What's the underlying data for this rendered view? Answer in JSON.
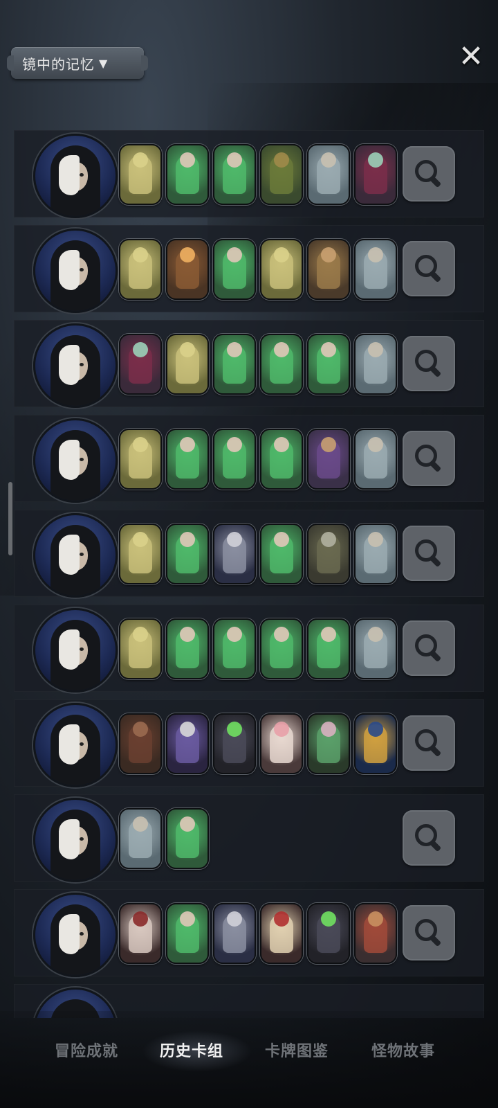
{
  "header": {
    "title": "镜中的记忆",
    "title_icon": "triangle-down-icon",
    "close_icon": "close-icon"
  },
  "colors": {
    "row_bg": "#191e25",
    "search_btn": "#5e6268",
    "tab_inactive": "#6f7378",
    "tab_active": "#f2f2f2"
  },
  "deck_rows": [
    {
      "cards": [
        "tentacle-monster-card",
        "green-hair-sorceress-card",
        "green-hair-sorceress-card",
        "horned-beast-card",
        "winged-demon-card",
        "flower-witch-card"
      ]
    },
    {
      "cards": [
        "tentacle-monster-card",
        "tree-golem-card",
        "green-hair-sorceress-card",
        "tentacle-monster-card",
        "scarecrow-card",
        "winged-demon-card"
      ]
    },
    {
      "cards": [
        "flower-witch-card",
        "tentacle-monster-card",
        "green-hair-sorceress-card",
        "green-hair-sorceress-card",
        "green-hair-sorceress-card",
        "winged-demon-card"
      ]
    },
    {
      "cards": [
        "tentacle-monster-card",
        "green-hair-sorceress-card",
        "green-hair-sorceress-card",
        "green-hair-sorceress-card",
        "hooded-mage-card",
        "winged-demon-card"
      ]
    },
    {
      "cards": [
        "tentacle-monster-card",
        "green-hair-sorceress-card",
        "armored-knight-card",
        "green-hair-sorceress-card",
        "dark-reaper-card",
        "winged-demon-card"
      ]
    },
    {
      "cards": [
        "tentacle-monster-card",
        "green-hair-sorceress-card",
        "green-hair-sorceress-card",
        "green-hair-sorceress-card",
        "green-hair-sorceress-card",
        "winged-demon-card"
      ]
    },
    {
      "cards": [
        "dark-lady-card",
        "skeleton-mage-card",
        "hooded-assassin-card",
        "pig-chef-card",
        "green-imp-card",
        "pharaoh-card"
      ]
    },
    {
      "cards": [
        "winged-demon-card",
        "green-hair-sorceress-card"
      ]
    },
    {
      "cards": [
        "horned-cow-card",
        "green-hair-sorceress-card",
        "armored-knight-card",
        "clown-card",
        "hooded-assassin-card",
        "mushroom-wizard-card"
      ]
    }
  ],
  "tabs": [
    {
      "label": "冒险成就",
      "active": false
    },
    {
      "label": "历史卡组",
      "active": true
    },
    {
      "label": "卡牌图鉴",
      "active": false
    },
    {
      "label": "怪物故事",
      "active": false
    }
  ]
}
